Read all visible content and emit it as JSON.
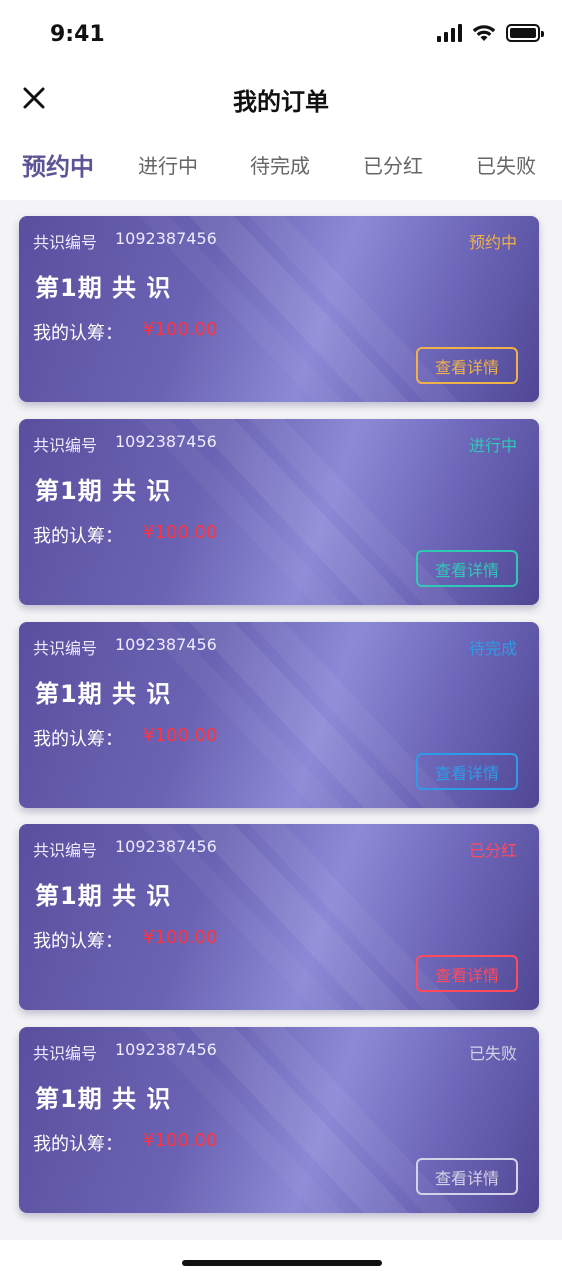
{
  "status_bar": {
    "time": "9:41"
  },
  "header": {
    "title": "我的订单",
    "close_icon": "close-icon"
  },
  "tabs": [
    {
      "label": "预约中",
      "active": true
    },
    {
      "label": "进行中",
      "active": false
    },
    {
      "label": "待完成",
      "active": false
    },
    {
      "label": "已分红",
      "active": false
    },
    {
      "label": "已失败",
      "active": false
    }
  ],
  "orders": [
    {
      "no_label": "共识编号",
      "no": "1092387456",
      "status": "预约中",
      "status_color": "#f0b14a",
      "title": "第1期 共 识",
      "amount_label": "我的认筹：",
      "amount": "¥100.00",
      "button": "查看详情"
    },
    {
      "no_label": "共识编号",
      "no": "1092387456",
      "status": "进行中",
      "status_color": "#2fc9b6",
      "title": "第1期 共 识",
      "amount_label": "我的认筹：",
      "amount": "¥100.00",
      "button": "查看详情"
    },
    {
      "no_label": "共识编号",
      "no": "1092387456",
      "status": "待完成",
      "status_color": "#2f9be8",
      "title": "第1期 共 识",
      "amount_label": "我的认筹：",
      "amount": "¥100.00",
      "button": "查看详情"
    },
    {
      "no_label": "共识编号",
      "no": "1092387456",
      "status": "已分红",
      "status_color": "#ff4a5e",
      "title": "第1期 共 识",
      "amount_label": "我的认筹：",
      "amount": "¥100.00",
      "button": "查看详情"
    },
    {
      "no_label": "共识编号",
      "no": "1092387456",
      "status": "已失败",
      "status_color": "#d4d2e6",
      "title": "第1期 共 识",
      "amount_label": "我的认筹：",
      "amount": "¥100.00",
      "button": "查看详情"
    }
  ]
}
